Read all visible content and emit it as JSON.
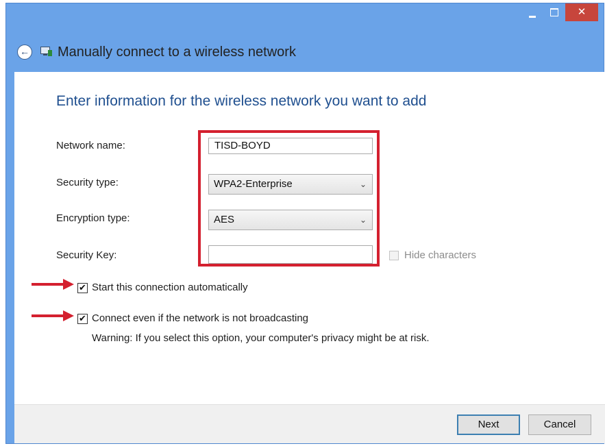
{
  "window": {
    "title": "Manually connect to a wireless network",
    "close_glyph": "✕"
  },
  "header": {
    "back_glyph": "←"
  },
  "form": {
    "heading": "Enter information for the wireless network you want to add",
    "network_name_label": "Network name:",
    "network_name_value": "TISD-BOYD",
    "security_type_label": "Security type:",
    "security_type_value": "WPA2-Enterprise",
    "encryption_type_label": "Encryption type:",
    "encryption_type_value": "AES",
    "security_key_label": "Security Key:",
    "security_key_value": "",
    "hide_characters_label": "Hide characters",
    "hide_characters_checked": false
  },
  "options": {
    "start_auto_label": "Start this connection automatically",
    "start_auto_checked": true,
    "connect_broadcast_label": "Connect even if the network is not broadcasting",
    "connect_broadcast_checked": true,
    "warning_text": "Warning: If you select this option, your computer's privacy might be at risk.",
    "check_glyph": "✔"
  },
  "footer": {
    "next_label": "Next",
    "cancel_label": "Cancel"
  },
  "colors": {
    "title_bar": "#6aa3e8",
    "close_button": "#c7453c",
    "heading_text": "#1f4f8f",
    "highlight_annotation": "#d4202f"
  },
  "icons": [
    "minimize-icon",
    "maximize-icon",
    "close-icon",
    "back-arrow-icon",
    "wireless-network-icon",
    "chevron-down-icon",
    "red-arrow-annotation"
  ]
}
